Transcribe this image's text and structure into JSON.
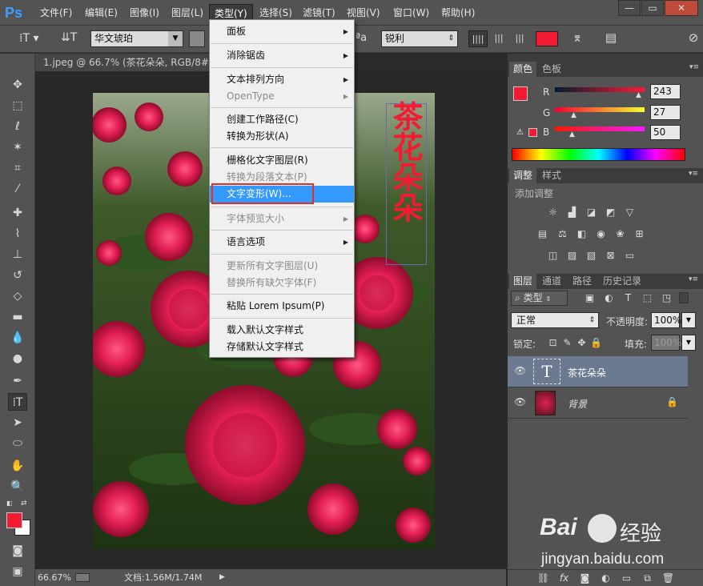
{
  "app": {
    "logo": "Ps"
  },
  "menubar": {
    "items": [
      "文件(F)",
      "编辑(E)",
      "图像(I)",
      "图层(L)",
      "类型(Y)",
      "选择(S)",
      "滤镜(T)",
      "视图(V)",
      "窗口(W)",
      "帮助(H)"
    ],
    "active": "类型(Y)"
  },
  "window_controls": {
    "minimize": "—",
    "restore": "▭",
    "close": "✕"
  },
  "optionsbar": {
    "font_family": "华文琥珀",
    "antialias": "锐利",
    "aa_label": "a",
    "color_hex": "#f31b32"
  },
  "document": {
    "tab_title": "1.jpeg @ 66.7% (茶花朵朵, RGB/8#) *",
    "vertical_text": "茶花朵朵"
  },
  "statusbar": {
    "zoom": "66.67%",
    "doc_size": "文档:1.56M/1.74M"
  },
  "type_menu": {
    "items": [
      {
        "label": "面板",
        "submenu": true,
        "disabled": false
      },
      {
        "label": "消除锯齿",
        "submenu": true,
        "disabled": false
      },
      {
        "label": "文本排列方向",
        "submenu": true,
        "disabled": false
      },
      {
        "label": "OpenType",
        "submenu": true,
        "disabled": true
      },
      {
        "label": "创建工作路径(C)",
        "submenu": false,
        "disabled": false
      },
      {
        "label": "转换为形状(A)",
        "submenu": false,
        "disabled": false
      },
      {
        "label": "栅格化文字图层(R)",
        "submenu": false,
        "disabled": false
      },
      {
        "label": "转换为段落文本(P)",
        "submenu": false,
        "disabled": true
      },
      {
        "label": "文字变形(W)...",
        "submenu": false,
        "disabled": false,
        "highlighted": true
      },
      {
        "label": "字体预览大小",
        "submenu": true,
        "disabled": true
      },
      {
        "label": "语言选项",
        "submenu": true,
        "disabled": false
      },
      {
        "label": "更新所有文字图层(U)",
        "submenu": false,
        "disabled": true
      },
      {
        "label": "替换所有缺欠字体(F)",
        "submenu": false,
        "disabled": true
      },
      {
        "label": "粘贴 Lorem Ipsum(P)",
        "submenu": false,
        "disabled": false
      },
      {
        "label": "载入默认文字样式",
        "submenu": false,
        "disabled": false
      },
      {
        "label": "存储默认文字样式",
        "submenu": false,
        "disabled": false
      }
    ]
  },
  "color_panel": {
    "tabs": [
      "颜色",
      "色板"
    ],
    "r_label": "R",
    "g_label": "G",
    "b_label": "B",
    "r": "243",
    "g": "27",
    "b": "50",
    "foreground_hex": "#f31b32"
  },
  "adjustments_panel": {
    "tabs": [
      "调整",
      "样式"
    ],
    "title": "添加调整"
  },
  "layers_panel": {
    "tabs": [
      "图层",
      "通道",
      "路径",
      "历史记录"
    ],
    "filter_label": "类型",
    "blend_mode": "正常",
    "opacity_label": "不透明度:",
    "opacity": "100%",
    "lock_label": "锁定:",
    "fill_label": "填充:",
    "fill": "100%",
    "layers": [
      {
        "name": "茶花朵朵",
        "type": "text",
        "selected": true,
        "thumb_glyph": "T"
      },
      {
        "name": "背景",
        "type": "image",
        "selected": false,
        "locked": true
      }
    ]
  },
  "watermark": {
    "brand": "Bai",
    "brand2": "经验",
    "url": "jingyan.baidu.com"
  }
}
